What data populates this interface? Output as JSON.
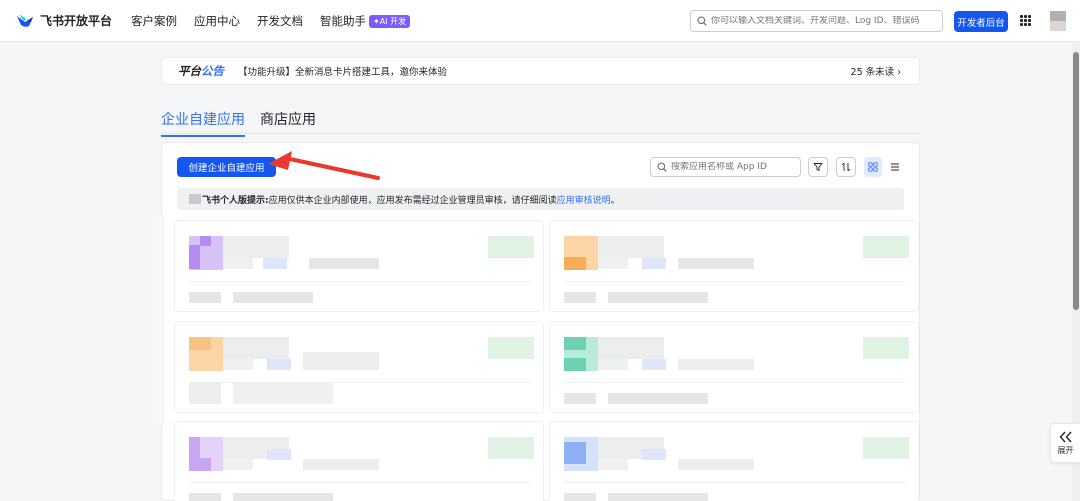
{
  "brand": {
    "name": "飞书开放平台"
  },
  "nav": {
    "links": [
      "客户案例",
      "应用中心",
      "开发文档",
      "智能助手"
    ],
    "ai_badge": "✦AI 开发",
    "search_placeholder": "你可以输入文档关键词、开发问题、Log ID、错误码",
    "console_button": "开发者后台"
  },
  "announcement": {
    "title_part1": "平台",
    "title_part2": "公告",
    "text": "【功能升级】全新消息卡片搭建工具，邀你来体验",
    "unread": "25 条未读"
  },
  "tabs": [
    {
      "label": "企业自建应用",
      "active": true
    },
    {
      "label": "商店应用",
      "active": false
    }
  ],
  "toolbar": {
    "create_button": "创建企业自建应用",
    "search_placeholder": "搜索应用名称或 App ID"
  },
  "tip": {
    "label": "飞书个人版提示:",
    "text": "应用仅供本企业内部使用，应用发布需经过企业管理员审核，请仔细阅读",
    "link": "应用审核说明",
    "end": "。"
  },
  "float": {
    "expand_label": "展开"
  },
  "colors": {
    "primary": "#1456f0",
    "link": "#3370ff",
    "arrow": "#e8392c",
    "card_accents": [
      "#c9a6f2",
      "#f8c283",
      "#c9a6f2",
      "#8fd9c2",
      "#d1b5f5",
      "#a6c1f7"
    ]
  }
}
